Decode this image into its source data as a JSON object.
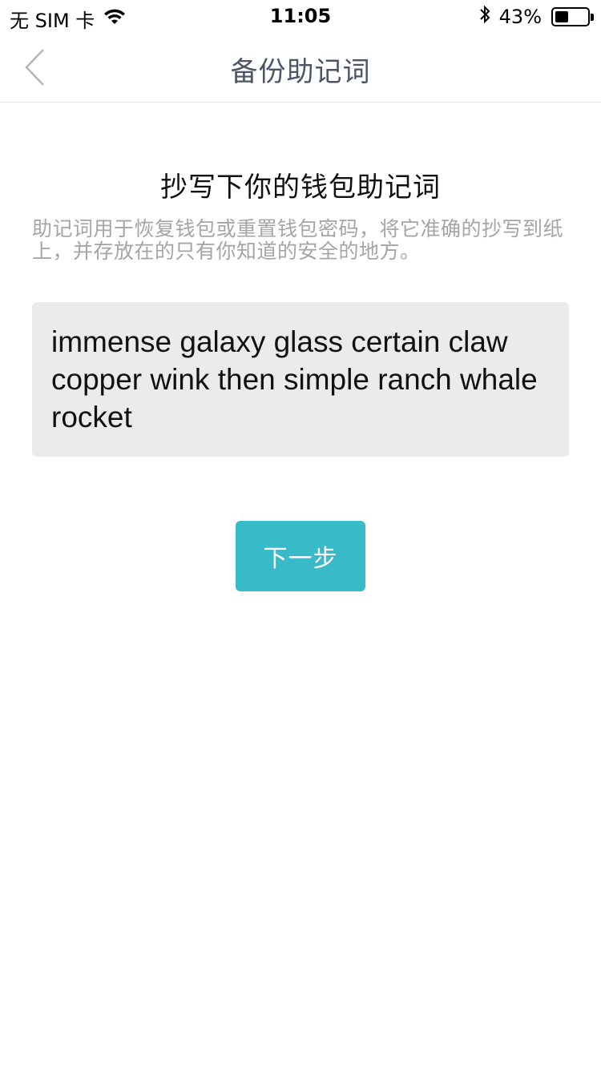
{
  "status_bar": {
    "carrier": "无 SIM 卡",
    "time": "11:05",
    "battery_percent": "43%",
    "battery_level": 0.43,
    "icons": [
      "wifi-icon",
      "bluetooth-icon",
      "battery-icon"
    ]
  },
  "nav": {
    "title": "备份助记词",
    "back_icon": "chevron-left-icon"
  },
  "content": {
    "headline": "抄写下你的钱包助记词",
    "description": "助记词用于恢复钱包或重置钱包密码，将它准确的抄写到纸上，并存放在的只有你知道的安全的地方。",
    "mnemonic": "immense galaxy glass certain claw copper wink then simple ranch whale rocket",
    "next_label": "下一步"
  },
  "colors": {
    "accent": "#38bac9",
    "title_text": "#4a5668",
    "muted_text": "#a5a5a5",
    "mnemonic_bg": "#ebebeb"
  }
}
